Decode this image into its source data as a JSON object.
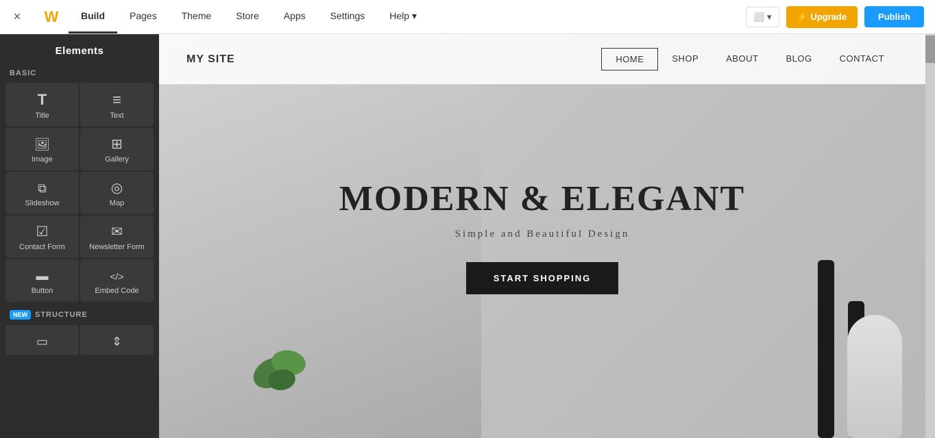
{
  "topNav": {
    "close_icon": "×",
    "logo": "W",
    "tabs": [
      {
        "label": "Build",
        "active": true
      },
      {
        "label": "Pages",
        "active": false
      },
      {
        "label": "Theme",
        "active": false
      },
      {
        "label": "Store",
        "active": false
      },
      {
        "label": "Apps",
        "active": false
      },
      {
        "label": "Settings",
        "active": false
      },
      {
        "label": "Help ▾",
        "active": false
      }
    ],
    "device_btn": "⬜ ▾",
    "upgrade_label": "⚡ Upgrade",
    "publish_label": "Publish"
  },
  "leftPanel": {
    "title": "Elements",
    "basic_label": "BASIC",
    "structure_label": "STRUCTURE",
    "new_badge": "NEW",
    "elements": [
      {
        "id": "title",
        "label": "Title",
        "icon": "icon-title"
      },
      {
        "id": "text",
        "label": "Text",
        "icon": "icon-text"
      },
      {
        "id": "image",
        "label": "Image",
        "icon": "icon-image"
      },
      {
        "id": "gallery",
        "label": "Gallery",
        "icon": "icon-gallery"
      },
      {
        "id": "slideshow",
        "label": "Slideshow",
        "icon": "icon-slideshow"
      },
      {
        "id": "map",
        "label": "Map",
        "icon": "icon-map"
      },
      {
        "id": "contact_form",
        "label": "Contact Form",
        "icon": "icon-contact-form"
      },
      {
        "id": "newsletter",
        "label": "Newsletter Form",
        "icon": "icon-newsletter"
      },
      {
        "id": "button",
        "label": "Button",
        "icon": "icon-button"
      },
      {
        "id": "embed",
        "label": "Embed Code",
        "icon": "icon-embed"
      }
    ],
    "structure_elements": [
      {
        "id": "box",
        "label": "",
        "icon": "icon-box"
      },
      {
        "id": "divider",
        "label": "",
        "icon": "icon-divider"
      }
    ]
  },
  "siteNav": {
    "logo": "MY SITE",
    "links": [
      {
        "label": "HOME",
        "active": true
      },
      {
        "label": "SHOP",
        "active": false
      },
      {
        "label": "ABOUT",
        "active": false
      },
      {
        "label": "BLOG",
        "active": false
      },
      {
        "label": "CONTACT",
        "active": false
      }
    ]
  },
  "hero": {
    "title": "MODERN & ELEGANT",
    "subtitle": "Simple and Beautiful Design",
    "cta_label": "START SHOPPING"
  }
}
